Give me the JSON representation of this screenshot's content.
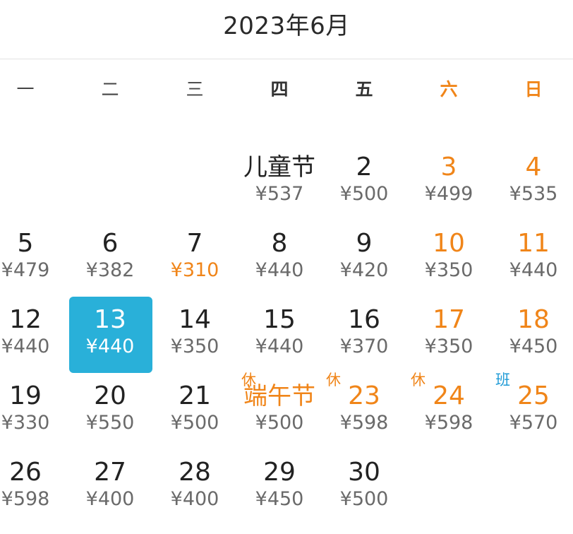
{
  "header": {
    "title": "2023年6月"
  },
  "weekdays": [
    "一",
    "二",
    "三",
    "四",
    "五",
    "六",
    "日"
  ],
  "weekend_color": "#f08519",
  "selected_color": "#29b0d9",
  "work_tag_color": "#1d9ad6",
  "days": [
    {
      "col": 4,
      "row": 1,
      "label": "儿童节",
      "price": "¥537"
    },
    {
      "col": 5,
      "row": 1,
      "label": "2",
      "price": "¥500"
    },
    {
      "col": 6,
      "row": 1,
      "label": "3",
      "price": "¥499",
      "weekend": true
    },
    {
      "col": 7,
      "row": 1,
      "label": "4",
      "price": "¥535",
      "weekend": true
    },
    {
      "col": 1,
      "row": 2,
      "label": "5",
      "price": "¥479"
    },
    {
      "col": 2,
      "row": 2,
      "label": "6",
      "price": "¥382"
    },
    {
      "col": 3,
      "row": 2,
      "label": "7",
      "price": "¥310",
      "cheap": true
    },
    {
      "col": 4,
      "row": 2,
      "label": "8",
      "price": "¥440"
    },
    {
      "col": 5,
      "row": 2,
      "label": "9",
      "price": "¥420"
    },
    {
      "col": 6,
      "row": 2,
      "label": "10",
      "price": "¥350",
      "weekend": true
    },
    {
      "col": 7,
      "row": 2,
      "label": "11",
      "price": "¥440",
      "weekend": true
    },
    {
      "col": 1,
      "row": 3,
      "label": "12",
      "price": "¥440"
    },
    {
      "col": 2,
      "row": 3,
      "label": "13",
      "price": "¥440",
      "selected": true
    },
    {
      "col": 3,
      "row": 3,
      "label": "14",
      "price": "¥350"
    },
    {
      "col": 4,
      "row": 3,
      "label": "15",
      "price": "¥440"
    },
    {
      "col": 5,
      "row": 3,
      "label": "16",
      "price": "¥370"
    },
    {
      "col": 6,
      "row": 3,
      "label": "17",
      "price": "¥350",
      "weekend": true
    },
    {
      "col": 7,
      "row": 3,
      "label": "18",
      "price": "¥450",
      "weekend": true
    },
    {
      "col": 1,
      "row": 4,
      "label": "19",
      "price": "¥330"
    },
    {
      "col": 2,
      "row": 4,
      "label": "20",
      "price": "¥550"
    },
    {
      "col": 3,
      "row": 4,
      "label": "21",
      "price": "¥500"
    },
    {
      "col": 4,
      "row": 4,
      "label": "端午节",
      "price": "¥500",
      "festival": true,
      "tag": "休"
    },
    {
      "col": 5,
      "row": 4,
      "label": "23",
      "price": "¥598",
      "weekend": true,
      "tag": "休"
    },
    {
      "col": 6,
      "row": 4,
      "label": "24",
      "price": "¥598",
      "weekend": true,
      "tag": "休"
    },
    {
      "col": 7,
      "row": 4,
      "label": "25",
      "price": "¥570",
      "weekend": true,
      "tag": "班",
      "tagType": "work"
    },
    {
      "col": 1,
      "row": 5,
      "label": "26",
      "price": "¥598"
    },
    {
      "col": 2,
      "row": 5,
      "label": "27",
      "price": "¥400"
    },
    {
      "col": 3,
      "row": 5,
      "label": "28",
      "price": "¥400"
    },
    {
      "col": 4,
      "row": 5,
      "label": "29",
      "price": "¥450"
    },
    {
      "col": 5,
      "row": 5,
      "label": "30",
      "price": "¥500"
    }
  ]
}
